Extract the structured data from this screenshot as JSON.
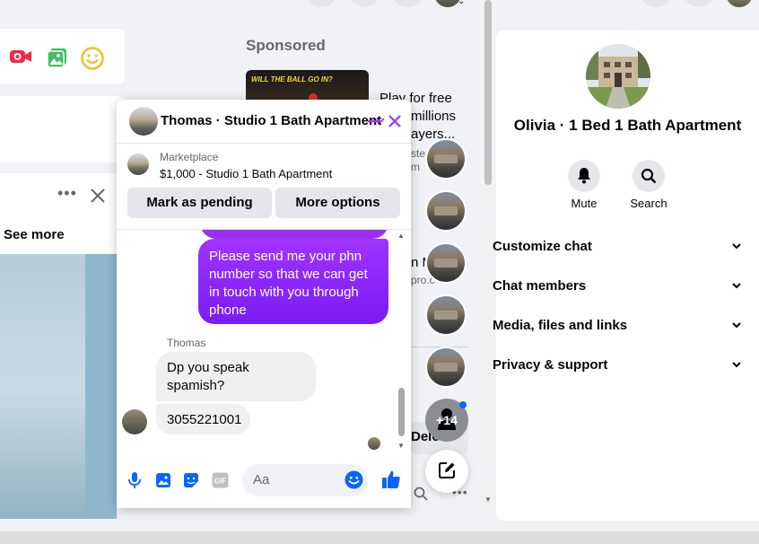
{
  "feed": {
    "sponsored_label": "Sponsored",
    "ad_text_lines": [
      "Play for free",
      "millions",
      "ayers..."
    ],
    "ad_domain_lines": [
      "steal",
      "m"
    ],
    "ad_image_caption": "WILL THE BALL GO IN?",
    "post_see_more": "See more",
    "partial_text_1": "n M",
    "partial_text_2": "pro.c",
    "partial_text_3": "Delet"
  },
  "chat": {
    "title": "Thomas · Studio 1 Bath Apartment",
    "marketplace_label": "Marketplace",
    "listing_title": "$1,000 - Studio 1 Bath Apartment",
    "mark_pending_label": "Mark as pending",
    "more_options_label": "More options",
    "outgoing_message": "Please send me your phn number so that we can get in touch with you through phone",
    "sender_name": "Thomas",
    "incoming_messages": [
      "Dp you speak spamish?",
      "3055221001"
    ],
    "composer_placeholder": "Aa"
  },
  "chatheads": {
    "overflow_count": "+14"
  },
  "right_panel": {
    "contact_name": "Olivia · 1 Bed 1 Bath Apartment",
    "mute_label": "Mute",
    "search_label": "Search",
    "sections": [
      "Customize chat",
      "Chat members",
      "Media, files and links",
      "Privacy & support"
    ]
  },
  "colors": {
    "accent_purple": "#a033ff",
    "accent_blue": "#0866ff",
    "messenger_gradient_start": "#a033ff",
    "messenger_gradient_end": "#7a1cf5"
  }
}
